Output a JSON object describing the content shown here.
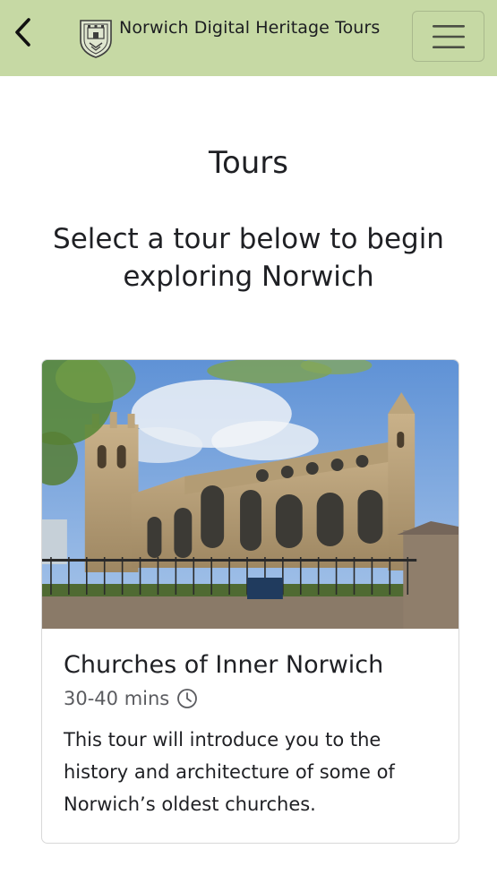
{
  "header": {
    "back_icon": "chevron-left-icon",
    "logo_icon": "norwich-crest-icon",
    "site_title": "Norwich Digital Heritage Tours",
    "menu_icon": "hamburger-menu-icon",
    "background_color": "#c6d9a4"
  },
  "main": {
    "title": "Tours",
    "subtitle": "Select a tour below to begin exploring Norwich"
  },
  "tours": [
    {
      "image": "church-photo",
      "title": "Churches of Inner Norwich",
      "duration": "30-40 mins",
      "duration_icon": "clock-icon",
      "description": "This tour will introduce you to the history and architecture of some of Norwich’s oldest churches."
    }
  ]
}
